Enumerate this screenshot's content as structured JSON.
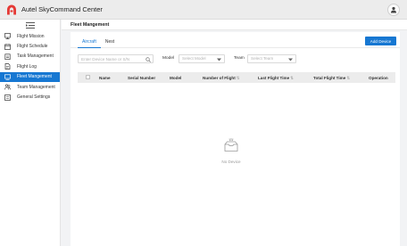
{
  "app": {
    "title": "Autel SkyCommand Center",
    "brand_color": "#e53935",
    "accent": "#1677d2"
  },
  "sidebar": {
    "items": [
      {
        "label": "Flight Mission",
        "icon": "flight-mission-icon",
        "active": false
      },
      {
        "label": "Flight Schedule",
        "icon": "calendar-icon",
        "active": false
      },
      {
        "label": "Task Management",
        "icon": "clipboard-icon",
        "active": false
      },
      {
        "label": "Flight Log",
        "icon": "log-icon",
        "active": false
      },
      {
        "label": "Fleet Mangement",
        "icon": "fleet-icon",
        "active": true
      },
      {
        "label": "Team Management",
        "icon": "team-icon",
        "active": false
      },
      {
        "label": "General Settings",
        "icon": "settings-icon",
        "active": false
      }
    ]
  },
  "page": {
    "title": "Fleet Mangement"
  },
  "tabs": [
    {
      "label": "Aircraft",
      "active": true
    },
    {
      "label": "Nest",
      "active": false
    }
  ],
  "toolbar": {
    "add_label": "Add Device"
  },
  "filters": {
    "search_placeholder": "Enter Device Name or S/N",
    "model_label": "Model",
    "model_placeholder": "Select Model",
    "team_label": "Team",
    "team_placeholder": "Select Team"
  },
  "table": {
    "columns": [
      {
        "label": "Name",
        "sortable": false
      },
      {
        "label": "Serial Number",
        "sortable": false
      },
      {
        "label": "Model",
        "sortable": false
      },
      {
        "label": "Number of Flight",
        "sortable": true
      },
      {
        "label": "Last Flight Time",
        "sortable": true
      },
      {
        "label": "Total Flight Time",
        "sortable": true
      },
      {
        "label": "Operation",
        "sortable": false
      }
    ],
    "sort_glyph": "⇅",
    "rows": [],
    "empty_text": "No Device"
  }
}
